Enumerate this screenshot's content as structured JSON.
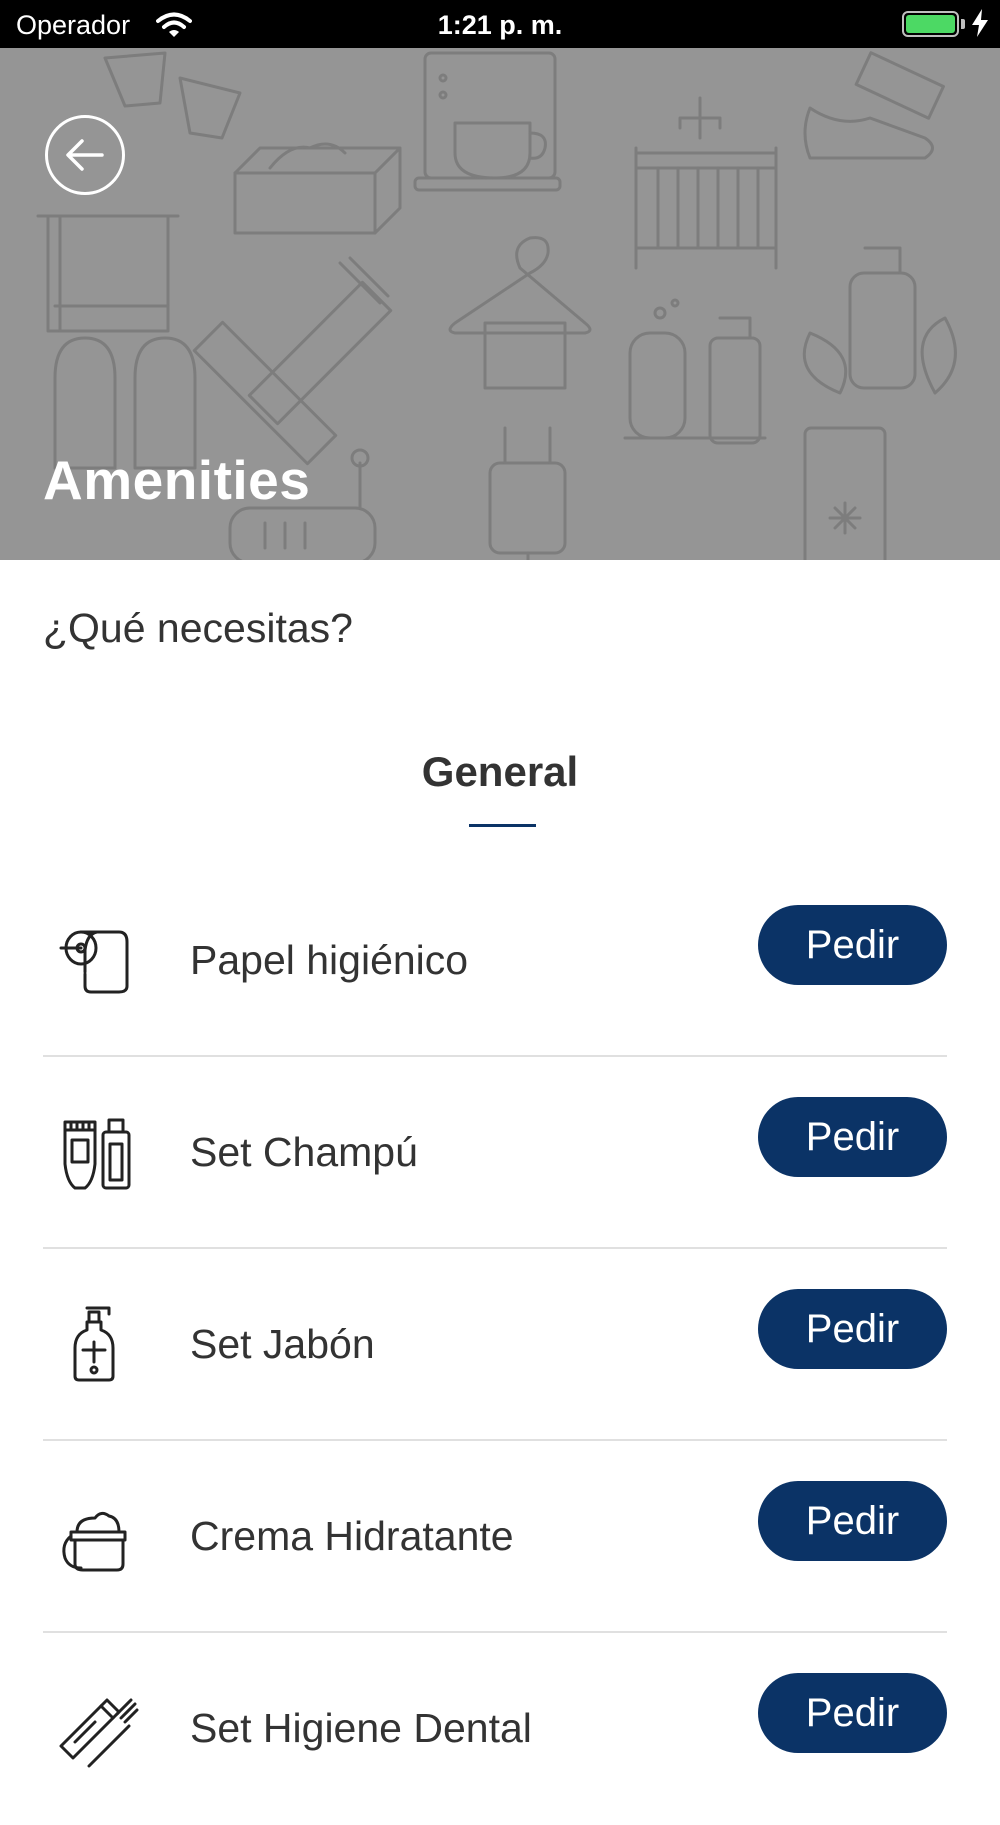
{
  "status_bar": {
    "carrier": "Operador",
    "time": "1:21 p. m.",
    "icons": [
      "wifi-icon",
      "battery-icon",
      "charging-icon"
    ],
    "battery_color": "#4cd964"
  },
  "header": {
    "title": "Amenities",
    "back_icon": "arrow-left-icon",
    "background_color": "#959595"
  },
  "question": "¿Qué necesitas?",
  "tabs": [
    {
      "label": "General",
      "active": true
    }
  ],
  "accent_color": "#0b3366",
  "items": [
    {
      "label": "Papel higiénico",
      "icon": "toilet-paper-icon",
      "button": "Pedir"
    },
    {
      "label": "Set Champú",
      "icon": "shampoo-bottles-icon",
      "button": "Pedir"
    },
    {
      "label": "Set Jabón",
      "icon": "soap-dispenser-icon",
      "button": "Pedir"
    },
    {
      "label": "Crema Hidratante",
      "icon": "cream-jar-icon",
      "button": "Pedir"
    },
    {
      "label": "Set Higiene Dental",
      "icon": "toothbrush-toothpaste-icon",
      "button": "Pedir"
    }
  ]
}
